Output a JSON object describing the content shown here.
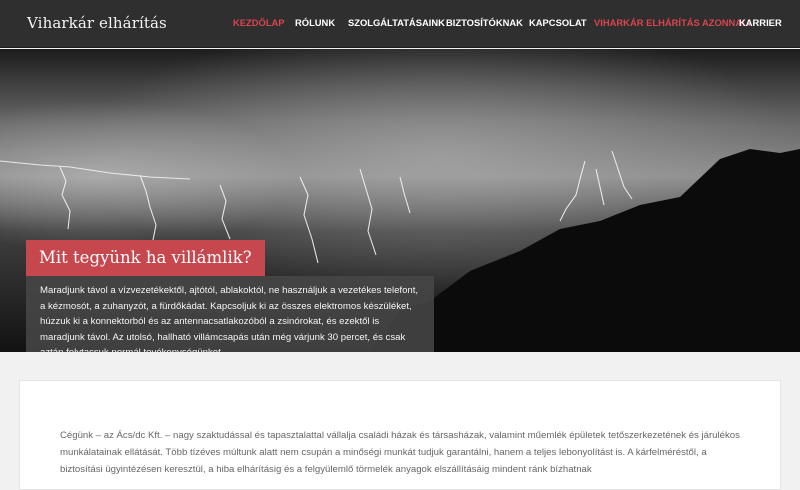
{
  "header": {
    "brand": "Viharkár elhárítás",
    "nav": [
      {
        "label": "KEZDŐLAP",
        "state": "active"
      },
      {
        "label": "RÓLUNK",
        "state": "normal"
      },
      {
        "label": "SZOLGÁLTATÁSAINK",
        "state": "normal"
      },
      {
        "label": "BIZTOSÍTÓKNAK",
        "state": "normal"
      },
      {
        "label": "KAPCSOLAT",
        "state": "normal"
      },
      {
        "label": "VIHARKÁR ELHÁRÍTÁS AZONNAL!",
        "state": "highlight"
      },
      {
        "label": "KARRIER",
        "state": "normal"
      }
    ]
  },
  "hero": {
    "title": "Mit tegyünk ha villámlik?",
    "text": "Maradjunk távol a vízvezetékektől, ajtótól, ablakoktól, ne használjuk a vezetékes telefont, a kézmosót, a zuhanyzót, a fürdőkádat. Kapcsoljuk ki az összes elektromos készüléket, húzzuk ki a konnektorból és az antennacsatlakozóból a zsinórokat, és ezektől is maradjunk távol. Az utolsó, hallható villámcsapás után még várjunk 30 percet, és csak aztán folytassuk normál tevékenységünket.",
    "slides": 3,
    "active_slide": 1
  },
  "content": {
    "text": "Cégünk – az Ács/dc Kft. – nagy szaktudással és tapasztalattal vállalja családi házak és társasházak, valamint műemlék épületek tetőszerkezetének és járulékos munkálatainak ellátását. Több tízéves múltunk alatt nem csupán a minőségi munkát tudjuk garantálni, hanem a teljes lebonyolítást is. A kárfelméréstől, a biztosítási ügyintézésen keresztül, a hiba elhárításig és a felgyülemlő törmelék anyagok elszállításáig mindent ránk bízhatnak"
  },
  "colors": {
    "navbar": "#2f2f2f",
    "accent": "#c7474e",
    "nav_active": "#d8454f",
    "background": "#f1f1f1"
  }
}
